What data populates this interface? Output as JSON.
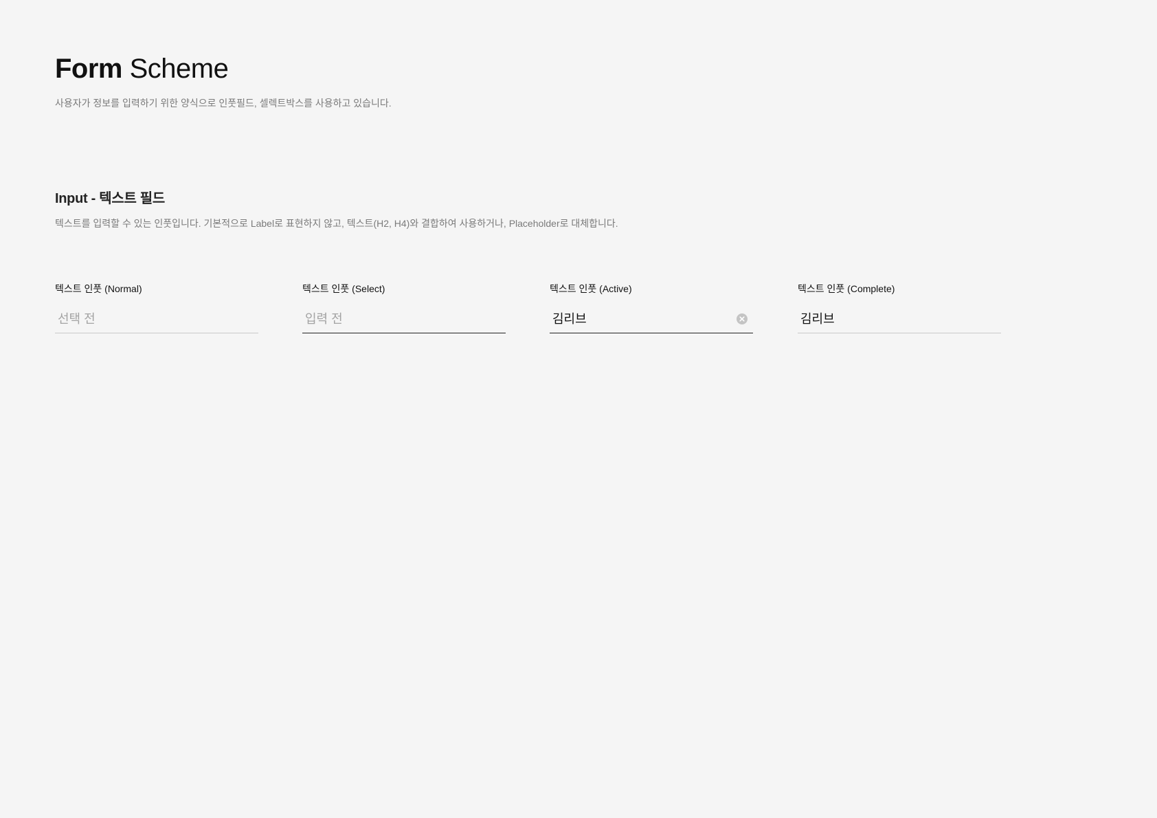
{
  "header": {
    "title_bold": "Form",
    "title_light": "Scheme",
    "subtitle": "사용자가 정보를 입력하기 위한 양식으로 인풋필드, 셀렉트박스를 사용하고 있습니다."
  },
  "section": {
    "title": "Input - 텍스트 필드",
    "description": "텍스트를 입력할 수 있는 인풋입니다. 기본적으로 Label로 표현하지 않고, 텍스트(H2, H4)와 결합하여 사용하거나, Placeholder로 대체합니다."
  },
  "fields": [
    {
      "label": "텍스트 인풋 (Normal)",
      "placeholder": "선택 전",
      "value": ""
    },
    {
      "label": "텍스트 인풋 (Select)",
      "placeholder": "입력 전",
      "value": ""
    },
    {
      "label": "텍스트 인풋 (Active)",
      "placeholder": "",
      "value": "김리브",
      "clear_icon": "clear-icon"
    },
    {
      "label": "텍스트 인풋 (Complete)",
      "placeholder": "",
      "value": "김리브"
    }
  ],
  "colors": {
    "background": "#f5f5f5",
    "underline_normal": "#c9c9c9",
    "underline_active": "#222222",
    "placeholder": "#a3a3a3"
  }
}
